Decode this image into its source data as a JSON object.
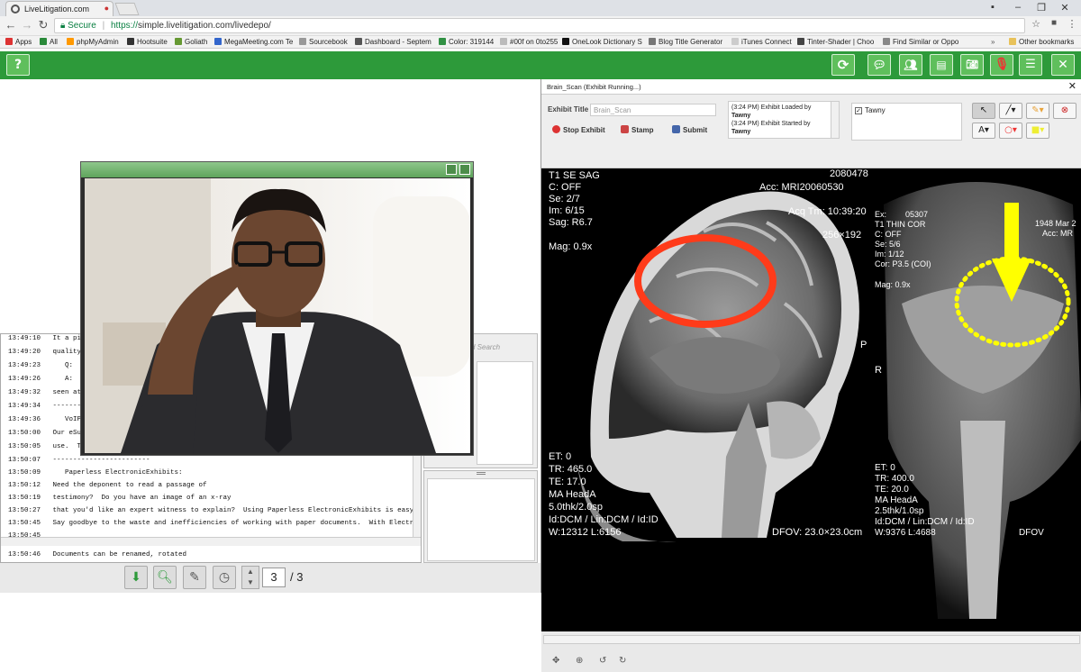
{
  "browser": {
    "tab_title": "LiveLitigation.com",
    "url_secure": "Secure",
    "url_scheme": "https://",
    "url_rest": "simple.livelitigation.com/livedepo/",
    "bookmarks": [
      "Apps",
      "All",
      "phpMyAdmin",
      "Hootsuite",
      "Goliath",
      "MegaMeeting.com Te",
      "Sourcebook",
      "Dashboard - Septem",
      "Color: 319144",
      "#00f on 0to255",
      "OneLook Dictionary S",
      "Blog Title Generator",
      "iTunes Connect",
      "Tinter-Shader | Choo",
      "Find Similar or Oppo",
      "Other bookmarks"
    ]
  },
  "app": {
    "help_label": "?",
    "close_label": "✕",
    "accent": "#2d9a3a"
  },
  "transcript": {
    "lines": [
      "13:49:10   It a pic",
      "13:49:20   quality",
      "13:49:23      Q:  I",
      "13:49:26      A:  W",
      "13:49:32   seen at",
      "13:49:34   --------",
      "13:49:36      VoIP",
      "13:50:00   Our eSui",
      "13:50:05   use.  Te",
      "13:50:07   ------------------------",
      "13:50:09      Paperless ElectronicExhibits:",
      "13:50:12   Need the deponent to read a passage of",
      "13:50:19   testimony?  Do you have an image of an x-ray",
      "13:50:27   that you'd like an expert witness to explain?  Using Paperless ElectronicExhibits is easy and",
      "13:50:45   Say goodbye to the waste and inefficiencies of working with paper documents.  With Electronic",
      "13:50:45",
      "13:50:46   Documents can be renamed, rotated"
    ]
  },
  "search": {
    "placeholder": "d Search"
  },
  "pager": {
    "current": "3",
    "total": "/ 3"
  },
  "exhibit": {
    "window_title": "Brain_Scan (Exhibit Running...)",
    "title_label": "Exhibit Title",
    "title_value": "Brain_Scan",
    "stop_label": "Stop Exhibit",
    "stamp_label": "Stamp",
    "submit_label": "Submit",
    "log": [
      {
        "time": "(3:24 PM) Exhibit Loaded by",
        "who": "Tawny"
      },
      {
        "time": "(3:24 PM) Exhibit Started by",
        "who": "Tawny"
      }
    ],
    "participant": "Tawny",
    "text_tool": "A",
    "mri_left": {
      "line1": "T1 SE SAG",
      "line2": "C: OFF",
      "line3": "Se: 2/7",
      "line4": "Im: 6/15",
      "line5": "Sag: R6.7",
      "mag": "Mag: 0.9x",
      "id_number": "2080478",
      "acc": "Acc: MRI20060530",
      "acq": "Acq Tm: 10:39:20",
      "matrix": "256×192",
      "side_p": "P",
      "side_r": "R",
      "et": "ET: 0",
      "tr": "TR: 465.0",
      "te": "TE: 17.0",
      "coil": "MA HeadA",
      "thk": "5.0thk/2.0sp",
      "lut": "Id:DCM / Lin:DCM / Id:ID",
      "wl": "W:12312  L:6156",
      "dfov": "DFOV: 23.0×23.0cm"
    },
    "mri_right": {
      "ex": "Ex:",
      "ex_no": "05307",
      "line1": "T1 THIN COR",
      "line2": "C: OFF",
      "line3": "Se: 5/6",
      "line4": "Im: 1/12",
      "line5": "Cor: P3.5 (COI)",
      "mag": "Mag: 0.9x",
      "date": "1948 Mar 2",
      "acc": "Acc: MR",
      "side_r": "R",
      "et": "ET: 0",
      "tr": "TR: 400.0",
      "te": "TE: 20.0",
      "coil": "MA HeadA",
      "thk": "2.5thk/1.0sp",
      "lut": "Id:DCM / Lin:DCM / Id:ID",
      "wl": "W:9376  L:4688",
      "dfov": "DFOV"
    },
    "annotation_colors": {
      "circle": "#ff3b1a",
      "arrow": "#ffff00"
    }
  }
}
